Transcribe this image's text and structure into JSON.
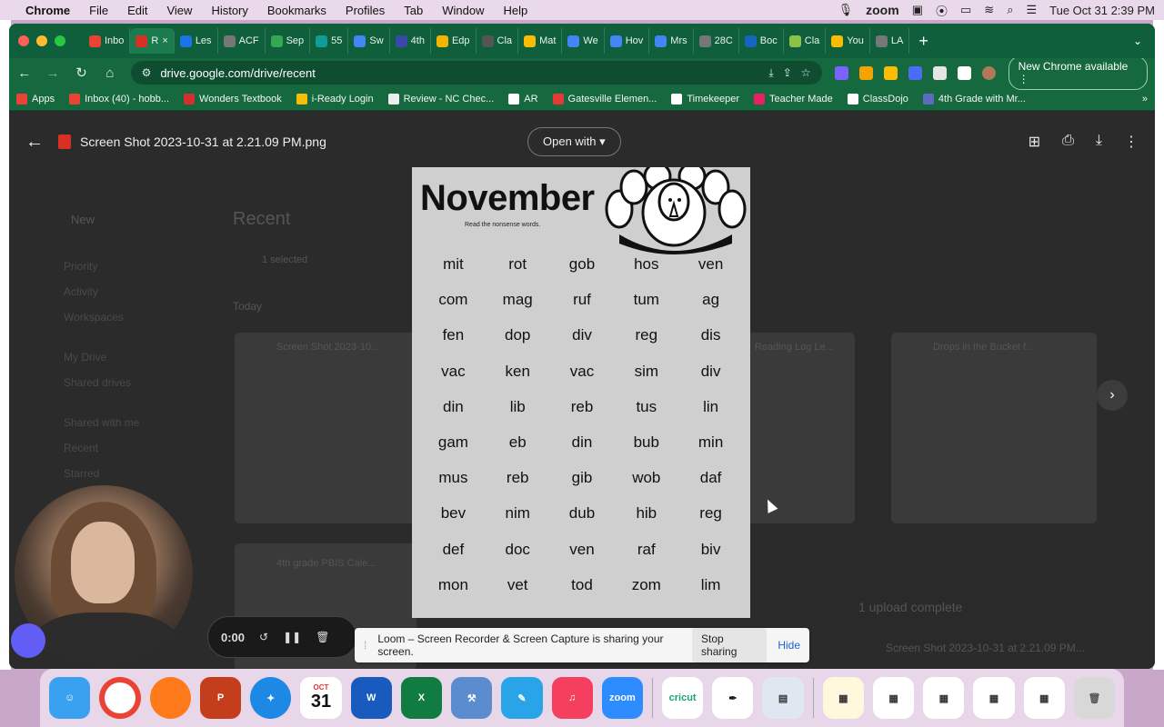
{
  "menubar": {
    "app": "Chrome",
    "items": [
      "File",
      "Edit",
      "View",
      "History",
      "Bookmarks",
      "Profiles",
      "Tab",
      "Window",
      "Help"
    ],
    "zoom": "zoom",
    "datetime": "Tue Oct 31  2:39 PM"
  },
  "tabs": [
    {
      "label": "Inbo",
      "color": "#ea4335"
    },
    {
      "label": "R",
      "color": "#d93025",
      "active": true
    },
    {
      "label": "Les",
      "color": "#1a73e8"
    },
    {
      "label": "ACF",
      "color": "#777777"
    },
    {
      "label": "Sep",
      "color": "#34a853"
    },
    {
      "label": "55",
      "color": "#0f9d9a"
    },
    {
      "label": "Sw",
      "color": "#4285f4"
    },
    {
      "label": "4th",
      "color": "#3949ab"
    },
    {
      "label": "Edp",
      "color": "#f4b400"
    },
    {
      "label": "Cla",
      "color": "#555555"
    },
    {
      "label": "Mat",
      "color": "#fbbc04"
    },
    {
      "label": "We",
      "color": "#4285f4"
    },
    {
      "label": "Hov",
      "color": "#4285f4"
    },
    {
      "label": "Mrs",
      "color": "#4285f4"
    },
    {
      "label": "28C",
      "color": "#777777"
    },
    {
      "label": "Boc",
      "color": "#1565c0"
    },
    {
      "label": "Cla",
      "color": "#8bc34a"
    },
    {
      "label": "You",
      "color": "#fbbc04"
    },
    {
      "label": "LA",
      "color": "#777777"
    }
  ],
  "toolbar": {
    "url": "drive.google.com/drive/recent",
    "new_chrome": "New Chrome available"
  },
  "bookmarks": [
    {
      "label": "Apps",
      "color": "#ea4335"
    },
    {
      "label": "Inbox (40) - hobb...",
      "color": "#ea4335"
    },
    {
      "label": "Wonders Textbook",
      "color": "#d32f2f"
    },
    {
      "label": "i-Ready Login",
      "color": "#fbbc04"
    },
    {
      "label": "Review - NC Chec...",
      "color": "#eeeeee"
    },
    {
      "label": "AR",
      "color": "#ffffff"
    },
    {
      "label": "Gatesville Elemen...",
      "color": "#e53935"
    },
    {
      "label": "Timekeeper",
      "color": "#ffffff"
    },
    {
      "label": "Teacher Made",
      "color": "#e91e63"
    },
    {
      "label": "ClassDojo",
      "color": "#ffffff"
    },
    {
      "label": "4th Grade with Mr...",
      "color": "#5c6bc0"
    }
  ],
  "viewer": {
    "filename": "Screen Shot 2023-10-31 at 2.21.09 PM.png",
    "open_with": "Open with"
  },
  "drive_dimmed": {
    "new": "New",
    "title": "Recent",
    "today": "Today",
    "selected": "1 selected",
    "sidebar": [
      "Priority",
      "Activity",
      "Workspaces",
      "My Drive",
      "Shared drives",
      "Shared with me",
      "Recent",
      "Starred"
    ],
    "files": [
      "Screen Shot 2023-10...",
      "Reading Log Le...",
      "Drops in the Bucket f...",
      "4th grade PBIS Cale..."
    ],
    "upload": "1 upload complete",
    "upload_file": "Screen Shot 2023-10-31 at 2.21.09 PM..."
  },
  "sheet": {
    "title": "November",
    "subtitle": "Read the nonsense words.",
    "words": [
      "mit",
      "rot",
      "gob",
      "hos",
      "ven",
      "com",
      "mag",
      "ruf",
      "tum",
      "ag",
      "fen",
      "dop",
      "div",
      "reg",
      "dis",
      "vac",
      "ken",
      "vac",
      "sim",
      "div",
      "din",
      "lib",
      "reb",
      "tus",
      "lin",
      "gam",
      "eb",
      "din",
      "bub",
      "min",
      "mus",
      "reb",
      "gib",
      "wob",
      "daf",
      "bev",
      "nim",
      "dub",
      "hib",
      "reg",
      "def",
      "doc",
      "ven",
      "raf",
      "biv",
      "mon",
      "vet",
      "tod",
      "zom",
      "lim"
    ]
  },
  "loom": {
    "time": "0:00",
    "share_text": "Loom – Screen Recorder & Screen Capture is sharing your screen.",
    "stop": "Stop sharing",
    "hide": "Hide"
  },
  "dock": {
    "cal_month": "OCT",
    "cal_day": "31",
    "zoom_label": "zoom",
    "cricut_label": "cricut"
  }
}
